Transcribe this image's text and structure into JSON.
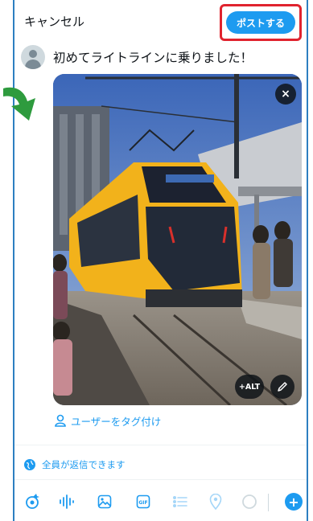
{
  "header": {
    "cancel_label": "キャンセル",
    "post_label": "ポストする"
  },
  "compose": {
    "text": "初めてライトラインに乗りました！"
  },
  "media": {
    "alt_label": "+ALT",
    "close_symbol": "×"
  },
  "tag": {
    "label": "ユーザーをタグ付け"
  },
  "reply": {
    "label": "全員が返信できます"
  },
  "toolbar": {
    "gif_label": "GIF",
    "icons": [
      "grok-icon",
      "voice-icon",
      "image-icon",
      "gif-icon",
      "poll-icon",
      "location-icon",
      "progress-circle-icon",
      "add-icon"
    ]
  },
  "colors": {
    "accent": "#1d9bf0",
    "highlight": "#e0232e",
    "arrow": "#2e9b3e",
    "frame": "#2d7fc1"
  }
}
